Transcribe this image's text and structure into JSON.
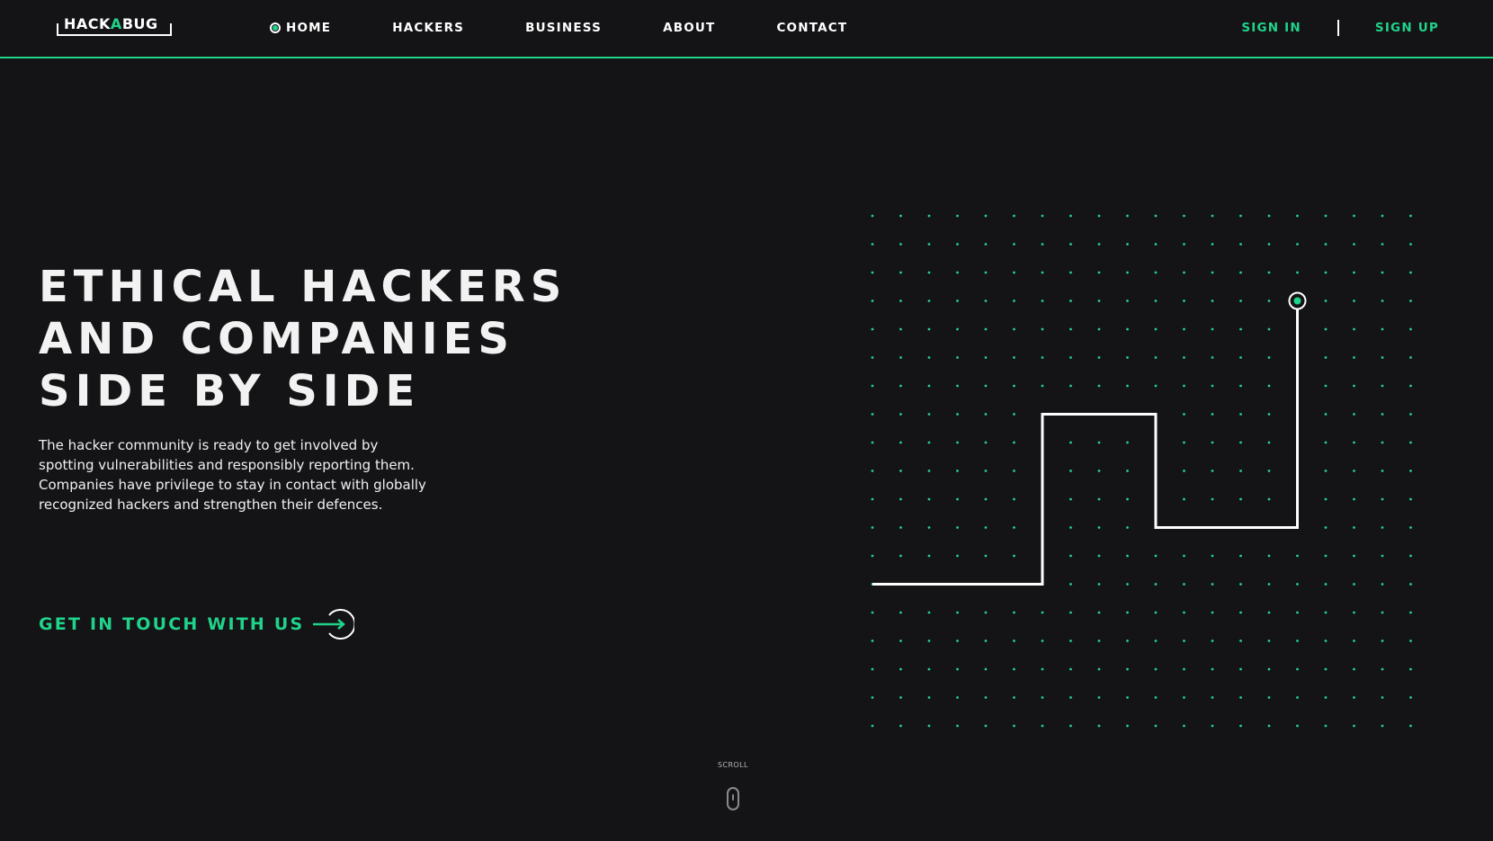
{
  "header": {
    "logo": {
      "part1": "HACK",
      "part2": "A",
      "part3": "BUG"
    },
    "nav": [
      {
        "label": "HOME",
        "active": true
      },
      {
        "label": "HACKERS",
        "active": false
      },
      {
        "label": "BUSINESS",
        "active": false
      },
      {
        "label": "ABOUT",
        "active": false
      },
      {
        "label": "CONTACT",
        "active": false
      }
    ],
    "sign_in": "SIGN IN",
    "sign_up": "SIGN UP"
  },
  "hero": {
    "title_lines": [
      "ETHICAL HACKERS",
      "AND COMPANIES",
      "SIDE BY SIDE"
    ],
    "description_lines": [
      "The hacker community is ready to get involved by",
      "spotting vulnerabilities and responsibly reporting them.",
      "Companies have privilege to stay in contact with globally",
      "recognized hackers and strengthen their defences."
    ],
    "cta_label": "GET IN TOUCH WITH US",
    "cta_icon": "arrow-circle-icon"
  },
  "graphic": {
    "icon": "dot-grid-path-icon"
  },
  "scroll": {
    "label": "SCROLL",
    "icon": "mouse-icon"
  },
  "colors": {
    "background": "#141316",
    "accent": "#20d38a",
    "text": "#ffffff"
  }
}
